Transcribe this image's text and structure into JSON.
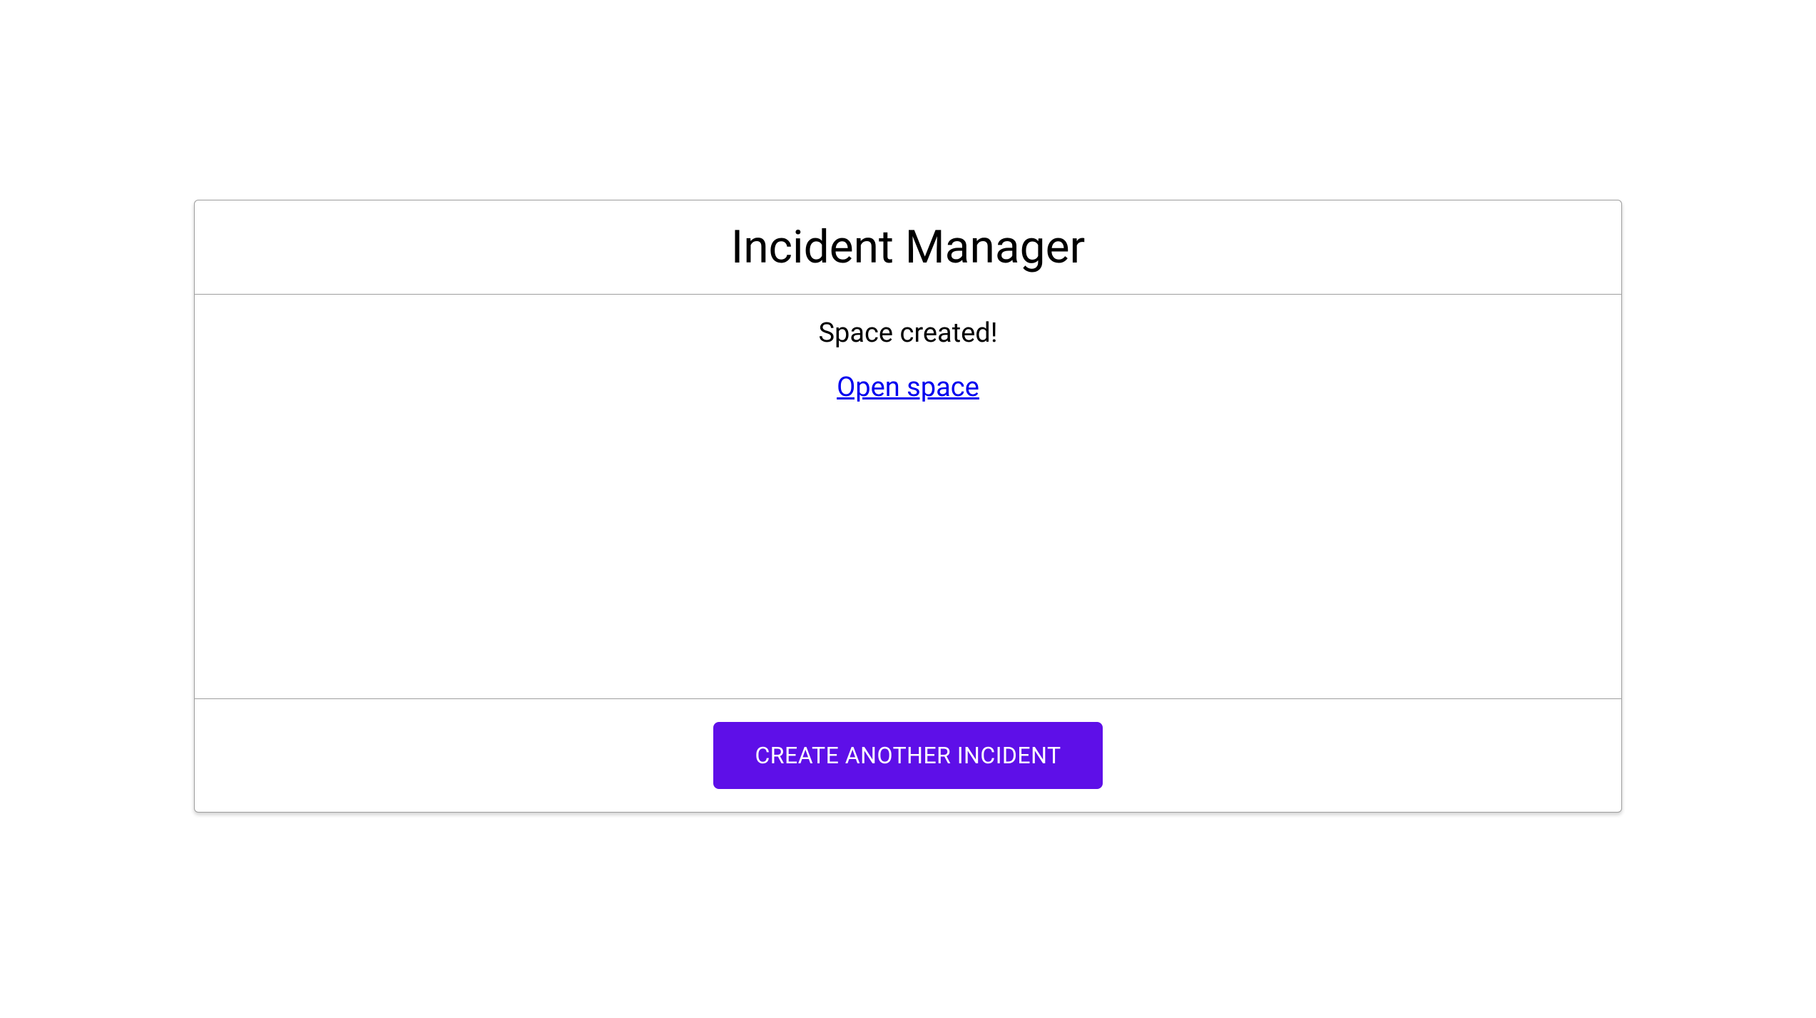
{
  "header": {
    "title": "Incident Manager"
  },
  "body": {
    "status_message": "Space created!",
    "link_label": "Open space"
  },
  "footer": {
    "button_label": "CREATE ANOTHER INCIDENT"
  },
  "colors": {
    "primary": "#5e0fe8",
    "link": "#0000ee",
    "border": "#9e9e9e"
  }
}
